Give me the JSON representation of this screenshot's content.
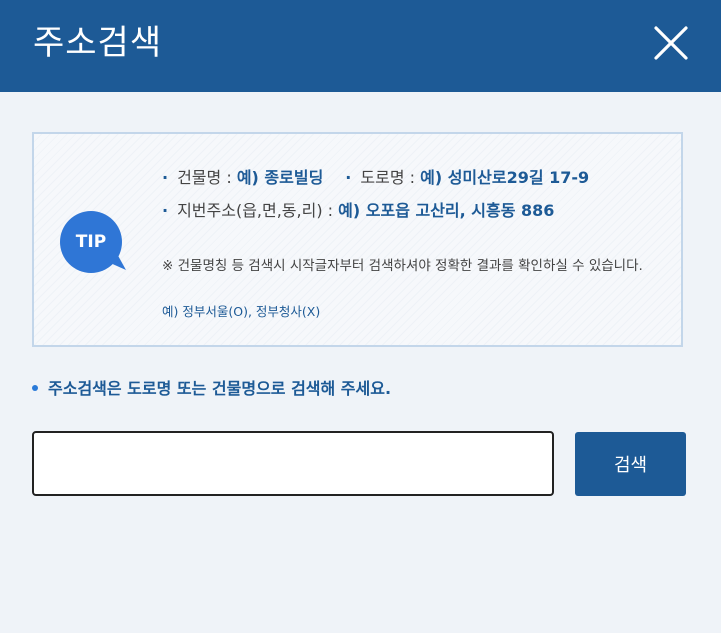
{
  "header": {
    "title": "주소검색",
    "close_icon": "close-icon"
  },
  "tip": {
    "badge": "TIP",
    "line1": {
      "building_label": "건물명 : ",
      "building_example": "예) 종로빌딩",
      "road_label": "도로명 : ",
      "road_example": "예) 성미산로29길 17-9"
    },
    "line2": {
      "lot_label": "지번주소(읍,면,동,리) : ",
      "lot_example": "예) 오포읍 고산리, 시흥동 886"
    },
    "note": "※ 건물명칭 등 검색시 시작글자부터 검색하셔야 정확한 결과를 확인하실 수 있습니다.",
    "example": "예) 정부서울(O), 정부청사(X)"
  },
  "guide": "주소검색은 도로명 또는 건물명으로 검색해 주세요.",
  "search": {
    "value": "",
    "button_label": "검색"
  },
  "colors": {
    "brand": "#1d5a96",
    "tip_badge": "#2f76d6",
    "background": "#eff3f8"
  }
}
